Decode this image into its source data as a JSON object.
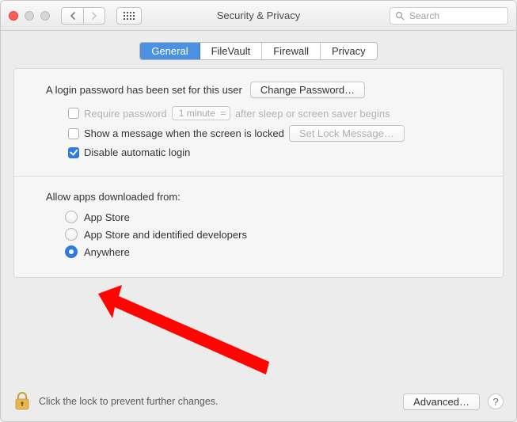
{
  "window": {
    "title": "Security & Privacy",
    "search_placeholder": "Search"
  },
  "tabs": {
    "general": "General",
    "filevault": "FileVault",
    "firewall": "Firewall",
    "privacy": "Privacy"
  },
  "login": {
    "set_text": "A login password has been set for this user",
    "change_password_btn": "Change Password…",
    "require_password_label": "Require password",
    "require_password_delay": "1 minute",
    "require_password_after": "after sleep or screen saver begins",
    "show_message_label": "Show a message when the screen is locked",
    "set_lock_message_btn": "Set Lock Message…",
    "disable_auto_login_label": "Disable automatic login"
  },
  "allow_apps": {
    "heading": "Allow apps downloaded from:",
    "opt_appstore": "App Store",
    "opt_identified": "App Store and identified developers",
    "opt_anywhere": "Anywhere"
  },
  "footer": {
    "lock_text": "Click the lock to prevent further changes.",
    "advanced_btn": "Advanced…",
    "help": "?"
  },
  "annotation": {
    "arrow_color": "#ff0400"
  }
}
